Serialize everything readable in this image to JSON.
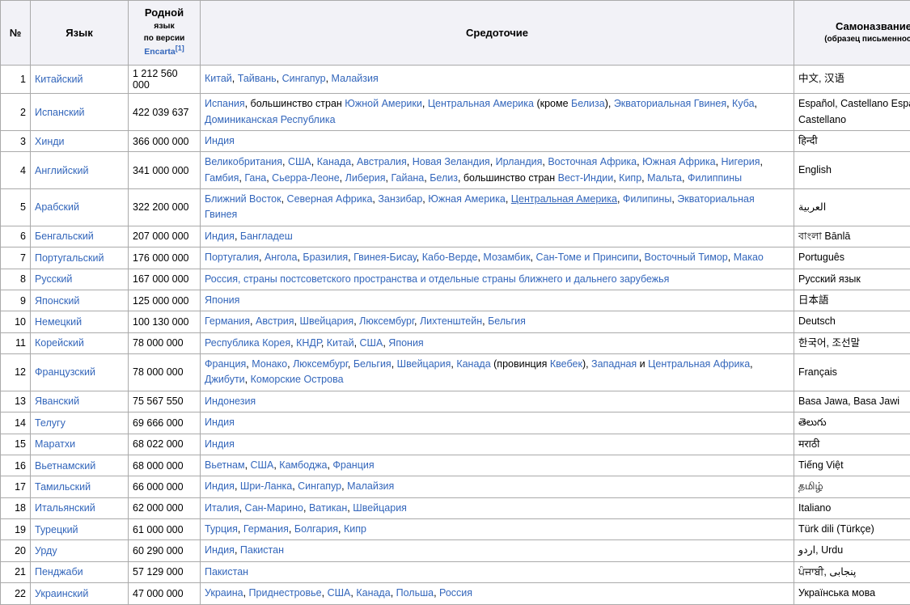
{
  "table": {
    "headers": {
      "num": "№",
      "language": "Язык",
      "native_main": "Родной",
      "native_main2": "язык",
      "native_note": "по версии",
      "native_source": "Encarta",
      "native_ref": "[1]",
      "focus": "Средоточие",
      "self_name": "Самоназвание",
      "self_name_note": "(образец письменности)"
    },
    "colors": {
      "link": "#3366bb",
      "header_bg": "#f2f2f7",
      "border": "#aaaaaa",
      "text": "#000000"
    },
    "rows": [
      {
        "num": "1",
        "language": "Китайский",
        "speakers": "1 212 560 000",
        "focus": [
          {
            "t": "Китай",
            "link": true
          },
          {
            "t": ", ",
            "link": false
          },
          {
            "t": "Тайвань",
            "link": true
          },
          {
            "t": ", ",
            "link": false
          },
          {
            "t": "Сингапур",
            "link": true
          },
          {
            "t": ", ",
            "link": false
          },
          {
            "t": "Малайзия",
            "link": true
          }
        ],
        "self_name": "中文, 汉语"
      },
      {
        "num": "2",
        "language": "Испанский",
        "speakers": "422 039 637",
        "focus": [
          {
            "t": "Испания",
            "link": true
          },
          {
            "t": ", большинство стран ",
            "link": false
          },
          {
            "t": "Южной Америки",
            "link": true
          },
          {
            "t": ", ",
            "link": false
          },
          {
            "t": "Центральная Америка",
            "link": true
          },
          {
            "t": " (кроме ",
            "link": false
          },
          {
            "t": "Белиза",
            "link": true
          },
          {
            "t": "), ",
            "link": false
          },
          {
            "t": "Экваториальная Гвинея",
            "link": true
          },
          {
            "t": ", ",
            "link": false
          },
          {
            "t": "Куба",
            "link": true
          },
          {
            "t": ", ",
            "link": false
          },
          {
            "t": "Доминиканская Республика",
            "link": true
          }
        ],
        "self_name": "Español, Castellano Español, Castellano"
      },
      {
        "num": "3",
        "language": "Хинди",
        "speakers": "366 000 000",
        "focus": [
          {
            "t": "Индия",
            "link": true
          }
        ],
        "self_name": "हिन्दी"
      },
      {
        "num": "4",
        "language": "Английский",
        "speakers": "341 000 000",
        "focus": [
          {
            "t": "Великобритания",
            "link": true
          },
          {
            "t": ", ",
            "link": false
          },
          {
            "t": "США",
            "link": true
          },
          {
            "t": ", ",
            "link": false
          },
          {
            "t": "Канада",
            "link": true
          },
          {
            "t": ", ",
            "link": false
          },
          {
            "t": "Австралия",
            "link": true
          },
          {
            "t": ", ",
            "link": false
          },
          {
            "t": "Новая Зеландия",
            "link": true
          },
          {
            "t": ", ",
            "link": false
          },
          {
            "t": "Ирландия",
            "link": true
          },
          {
            "t": ", ",
            "link": false
          },
          {
            "t": "Восточная Африка",
            "link": true
          },
          {
            "t": ", ",
            "link": false
          },
          {
            "t": "Южная Африка",
            "link": true
          },
          {
            "t": ", ",
            "link": false
          },
          {
            "t": "Нигерия",
            "link": true
          },
          {
            "t": ", ",
            "link": false
          },
          {
            "t": "Гамбия",
            "link": true
          },
          {
            "t": ", ",
            "link": false
          },
          {
            "t": "Гана",
            "link": true
          },
          {
            "t": ", ",
            "link": false
          },
          {
            "t": "Сьерра-Леоне",
            "link": true
          },
          {
            "t": ", ",
            "link": false
          },
          {
            "t": "Либерия",
            "link": true
          },
          {
            "t": ", ",
            "link": false
          },
          {
            "t": "Гайана",
            "link": true
          },
          {
            "t": ", ",
            "link": false
          },
          {
            "t": "Белиз",
            "link": true
          },
          {
            "t": ", большинство стран ",
            "link": false
          },
          {
            "t": "Вест-Индии",
            "link": true
          },
          {
            "t": ", ",
            "link": false
          },
          {
            "t": "Кипр",
            "link": true
          },
          {
            "t": ", ",
            "link": false
          },
          {
            "t": "Мальта",
            "link": true
          },
          {
            "t": ", ",
            "link": false
          },
          {
            "t": "Филиппины",
            "link": true
          }
        ],
        "self_name": "English"
      },
      {
        "num": "5",
        "language": "Арабский",
        "speakers": "322 200 000",
        "focus": [
          {
            "t": "Ближний Восток",
            "link": true
          },
          {
            "t": ", ",
            "link": false
          },
          {
            "t": "Северная Африка",
            "link": true
          },
          {
            "t": ", ",
            "link": false
          },
          {
            "t": "Занзибар",
            "link": true
          },
          {
            "t": ", ",
            "link": false
          },
          {
            "t": "Южная Америка",
            "link": true
          },
          {
            "t": ", ",
            "link": false
          },
          {
            "t": "Центральная Америка",
            "link": true,
            "hover": true
          },
          {
            "t": ", ",
            "link": false
          },
          {
            "t": "Филипины",
            "link": true
          },
          {
            "t": ", ",
            "link": false
          },
          {
            "t": "Экваториальная Гвинея",
            "link": true
          }
        ],
        "self_name": "العربية"
      },
      {
        "num": "6",
        "language": "Бенгальский",
        "speakers": "207 000 000",
        "focus": [
          {
            "t": "Индия",
            "link": true
          },
          {
            "t": ", ",
            "link": false
          },
          {
            "t": "Бангладеш",
            "link": true
          }
        ],
        "self_name": "বাংলা Bānlā"
      },
      {
        "num": "7",
        "language": "Португальский",
        "speakers": "176 000 000",
        "focus": [
          {
            "t": "Португалия",
            "link": true
          },
          {
            "t": ", ",
            "link": false
          },
          {
            "t": "Ангола",
            "link": true
          },
          {
            "t": ", ",
            "link": false
          },
          {
            "t": "Бразилия",
            "link": true
          },
          {
            "t": ", ",
            "link": false
          },
          {
            "t": "Гвинея-Бисау",
            "link": true
          },
          {
            "t": ", ",
            "link": false
          },
          {
            "t": "Кабо-Верде",
            "link": true
          },
          {
            "t": ", ",
            "link": false
          },
          {
            "t": "Мозамбик",
            "link": true
          },
          {
            "t": ", ",
            "link": false
          },
          {
            "t": "Сан-Томе и Принсипи",
            "link": true
          },
          {
            "t": ", ",
            "link": false
          },
          {
            "t": "Восточный Тимор",
            "link": true
          },
          {
            "t": ", ",
            "link": false
          },
          {
            "t": "Макао",
            "link": true
          }
        ],
        "self_name": "Português"
      },
      {
        "num": "8",
        "language": "Русский",
        "speakers": "167 000 000",
        "focus": [
          {
            "t": "Россия",
            "link": true
          },
          {
            "t": ", страны постсоветского пространства и отдельные страны ближнего и дальнего зарубежья",
            "link": true
          }
        ],
        "self_name": "Русский язык"
      },
      {
        "num": "9",
        "language": "Японский",
        "speakers": "125 000 000",
        "focus": [
          {
            "t": "Япония",
            "link": true
          }
        ],
        "self_name": "日本語"
      },
      {
        "num": "10",
        "language": "Немецкий",
        "speakers": "100 130 000",
        "focus": [
          {
            "t": "Германия",
            "link": true
          },
          {
            "t": ", ",
            "link": false
          },
          {
            "t": "Австрия",
            "link": true
          },
          {
            "t": ", ",
            "link": false
          },
          {
            "t": "Швейцария",
            "link": true
          },
          {
            "t": ", ",
            "link": false
          },
          {
            "t": "Люксембург",
            "link": true
          },
          {
            "t": ", ",
            "link": false
          },
          {
            "t": "Лихтенштейн",
            "link": true
          },
          {
            "t": ", ",
            "link": false
          },
          {
            "t": "Бельгия",
            "link": true
          }
        ],
        "self_name": "Deutsch"
      },
      {
        "num": "11",
        "language": "Корейский",
        "speakers": "78 000 000",
        "focus": [
          {
            "t": "Республика Корея",
            "link": true
          },
          {
            "t": ", ",
            "link": false
          },
          {
            "t": "КНДР",
            "link": true
          },
          {
            "t": ", ",
            "link": false
          },
          {
            "t": "Китай",
            "link": true
          },
          {
            "t": ", ",
            "link": false
          },
          {
            "t": "США",
            "link": true
          },
          {
            "t": ", ",
            "link": false
          },
          {
            "t": "Япония",
            "link": true
          }
        ],
        "self_name": "한국어, 조선말"
      },
      {
        "num": "12",
        "language": "Французский",
        "speakers": "78 000 000",
        "focus": [
          {
            "t": "Франция",
            "link": true
          },
          {
            "t": ", ",
            "link": false
          },
          {
            "t": "Монако",
            "link": true
          },
          {
            "t": ", ",
            "link": false
          },
          {
            "t": "Люксембург",
            "link": true
          },
          {
            "t": ", ",
            "link": false
          },
          {
            "t": "Бельгия",
            "link": true
          },
          {
            "t": ", ",
            "link": false
          },
          {
            "t": "Швейцария",
            "link": true
          },
          {
            "t": ", ",
            "link": false
          },
          {
            "t": "Канада",
            "link": true
          },
          {
            "t": " (провинция ",
            "link": false
          },
          {
            "t": "Квебек",
            "link": true
          },
          {
            "t": "), ",
            "link": false
          },
          {
            "t": "Западная",
            "link": true
          },
          {
            "t": " и ",
            "link": false
          },
          {
            "t": "Центральная Африка",
            "link": true
          },
          {
            "t": ", ",
            "link": false
          },
          {
            "t": "Джибути",
            "link": true
          },
          {
            "t": ", ",
            "link": false
          },
          {
            "t": "Коморские Острова",
            "link": true
          }
        ],
        "self_name": "Français"
      },
      {
        "num": "13",
        "language": "Яванский",
        "speakers": "75 567 550",
        "focus": [
          {
            "t": "Индонезия",
            "link": true
          }
        ],
        "self_name": "Basa Jawa, Basa Jawi"
      },
      {
        "num": "14",
        "language": "Телугу",
        "speakers": "69 666 000",
        "focus": [
          {
            "t": "Индия",
            "link": true
          }
        ],
        "self_name": "తెలుగు"
      },
      {
        "num": "15",
        "language": "Маратхи",
        "speakers": "68 022 000",
        "focus": [
          {
            "t": "Индия",
            "link": true
          }
        ],
        "self_name": "मराठी"
      },
      {
        "num": "16",
        "language": "Вьетнамский",
        "speakers": "68 000 000",
        "focus": [
          {
            "t": "Вьетнам",
            "link": true
          },
          {
            "t": ", ",
            "link": false
          },
          {
            "t": "США",
            "link": true
          },
          {
            "t": ", ",
            "link": false
          },
          {
            "t": "Камбоджа",
            "link": true
          },
          {
            "t": ", ",
            "link": false
          },
          {
            "t": "Франция",
            "link": true
          }
        ],
        "self_name": "Tiếng Việt"
      },
      {
        "num": "17",
        "language": "Тамильский",
        "speakers": "66 000 000",
        "focus": [
          {
            "t": "Индия",
            "link": true
          },
          {
            "t": ", ",
            "link": false
          },
          {
            "t": "Шри-Ланка",
            "link": true
          },
          {
            "t": ", ",
            "link": false
          },
          {
            "t": "Сингапур",
            "link": true
          },
          {
            "t": ", ",
            "link": false
          },
          {
            "t": "Малайзия",
            "link": true
          }
        ],
        "self_name": "தமிழ்"
      },
      {
        "num": "18",
        "language": "Итальянский",
        "speakers": "62 000 000",
        "focus": [
          {
            "t": "Италия",
            "link": true
          },
          {
            "t": ", ",
            "link": false
          },
          {
            "t": "Сан-Марино",
            "link": true
          },
          {
            "t": ", ",
            "link": false
          },
          {
            "t": "Ватикан",
            "link": true
          },
          {
            "t": ", ",
            "link": false
          },
          {
            "t": "Швейцария",
            "link": true
          }
        ],
        "self_name": "Italiano"
      },
      {
        "num": "19",
        "language": "Турецкий",
        "speakers": "61 000 000",
        "focus": [
          {
            "t": "Турция",
            "link": true
          },
          {
            "t": ", ",
            "link": false
          },
          {
            "t": "Германия",
            "link": true
          },
          {
            "t": ", ",
            "link": false
          },
          {
            "t": "Болгария",
            "link": true
          },
          {
            "t": ", ",
            "link": false
          },
          {
            "t": "Кипр",
            "link": true
          }
        ],
        "self_name": "Türk dili (Türkçe)"
      },
      {
        "num": "20",
        "language": "Урду",
        "speakers": "60 290 000",
        "focus": [
          {
            "t": "Индия",
            "link": true
          },
          {
            "t": ", ",
            "link": false
          },
          {
            "t": "Пакистан",
            "link": true
          }
        ],
        "self_name": "اردو, Urdu"
      },
      {
        "num": "21",
        "language": "Пенджаби",
        "speakers": "57 129 000",
        "focus": [
          {
            "t": "Пакистан",
            "link": true
          }
        ],
        "self_name": "ਪੰਜਾਬੀ, پنجابی"
      },
      {
        "num": "22",
        "language": "Украинский",
        "speakers": "47 000 000",
        "focus": [
          {
            "t": "Украина",
            "link": true
          },
          {
            "t": ", ",
            "link": false
          },
          {
            "t": "Приднестровье",
            "link": true
          },
          {
            "t": ", ",
            "link": false
          },
          {
            "t": "США",
            "link": true
          },
          {
            "t": ", ",
            "link": false
          },
          {
            "t": "Канада",
            "link": true
          },
          {
            "t": ", ",
            "link": false
          },
          {
            "t": "Польша",
            "link": true
          },
          {
            "t": ", ",
            "link": false
          },
          {
            "t": "Россия",
            "link": true
          }
        ],
        "self_name": "Українська мова"
      }
    ]
  }
}
